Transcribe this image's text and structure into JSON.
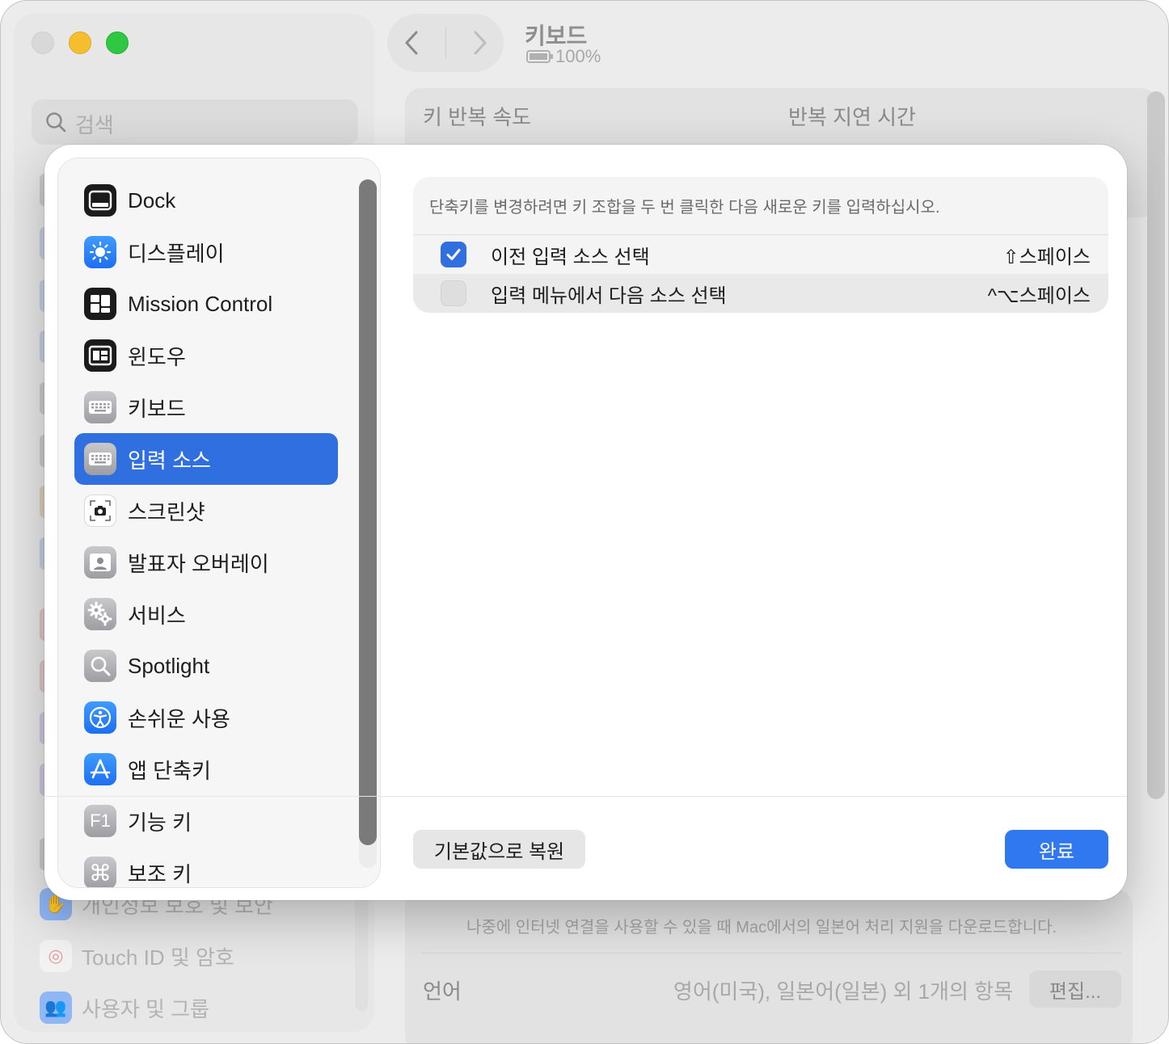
{
  "window": {
    "title": "키보드",
    "battery": "100%",
    "search_placeholder": "검색"
  },
  "background": {
    "column_labels": [
      "키 반복 속도",
      "반복 지연 시간"
    ],
    "sidebar_footer": [
      {
        "label": "개인정보 보호 및 보안",
        "icon": "hand-icon",
        "color": "#4f8ef7"
      },
      {
        "label": "Touch ID 및 암호",
        "icon": "fingerprint-icon",
        "color": "#f2f2f2"
      },
      {
        "label": "사용자 및 그룹",
        "icon": "users-icon",
        "color": "#4f8ef7"
      }
    ],
    "note": "나중에 인터넷 연결을 사용할 수 있을 때 Mac에서의 일본어 처리 지원을 다운로드합니다.",
    "language_label": "언어",
    "language_value": "영어(미국), 일본어(일본) 외 1개의 항목",
    "edit_button": "편집..."
  },
  "sheet": {
    "sidebar": [
      {
        "label": "Dock",
        "icon": "dock-icon",
        "style": "ic-black",
        "selected": false
      },
      {
        "label": "디스플레이",
        "icon": "sun-icon",
        "style": "ic-blue",
        "selected": false
      },
      {
        "label": "Mission Control",
        "icon": "mission-control-icon",
        "style": "ic-black",
        "selected": false
      },
      {
        "label": "윈도우",
        "icon": "window-icon",
        "style": "ic-black",
        "selected": false
      },
      {
        "label": "키보드",
        "icon": "keyboard-icon",
        "style": "ic-gray",
        "selected": false
      },
      {
        "label": "입력 소스",
        "icon": "keyboard-icon",
        "style": "ic-gray",
        "selected": true
      },
      {
        "label": "스크린샷",
        "icon": "camera-icon",
        "style": "ic-white",
        "selected": false
      },
      {
        "label": "발표자 오버레이",
        "icon": "presenter-icon",
        "style": "ic-gray",
        "selected": false
      },
      {
        "label": "서비스",
        "icon": "gears-icon",
        "style": "ic-gray",
        "selected": false
      },
      {
        "label": "Spotlight",
        "icon": "magnifier-icon",
        "style": "ic-gray",
        "selected": false
      },
      {
        "label": "손쉬운 사용",
        "icon": "accessibility-icon",
        "style": "ic-blue",
        "selected": false
      },
      {
        "label": "앱 단축키",
        "icon": "app-store-icon",
        "style": "ic-blue",
        "selected": false
      },
      {
        "label": "기능 키",
        "icon": "f1-icon",
        "style": "ic-gray",
        "selected": false
      },
      {
        "label": "보조 키",
        "icon": "command-icon",
        "style": "ic-gray",
        "selected": false
      }
    ],
    "f1_text": "F1",
    "instruction": "단축키를 변경하려면 키 조합을 두 번 클릭한 다음 새로운 키를 입력하십시오.",
    "shortcuts": [
      {
        "label": "이전 입력 소스 선택",
        "key": "⇧스페이스",
        "checked": true
      },
      {
        "label": "입력 메뉴에서 다음 소스 선택",
        "key": "^⌥스페이스",
        "checked": false
      }
    ],
    "restore_button": "기본값으로 복원",
    "done_button": "완료"
  },
  "colors": {
    "accent": "#2f6fe0",
    "done_button": "#2f78f0"
  }
}
